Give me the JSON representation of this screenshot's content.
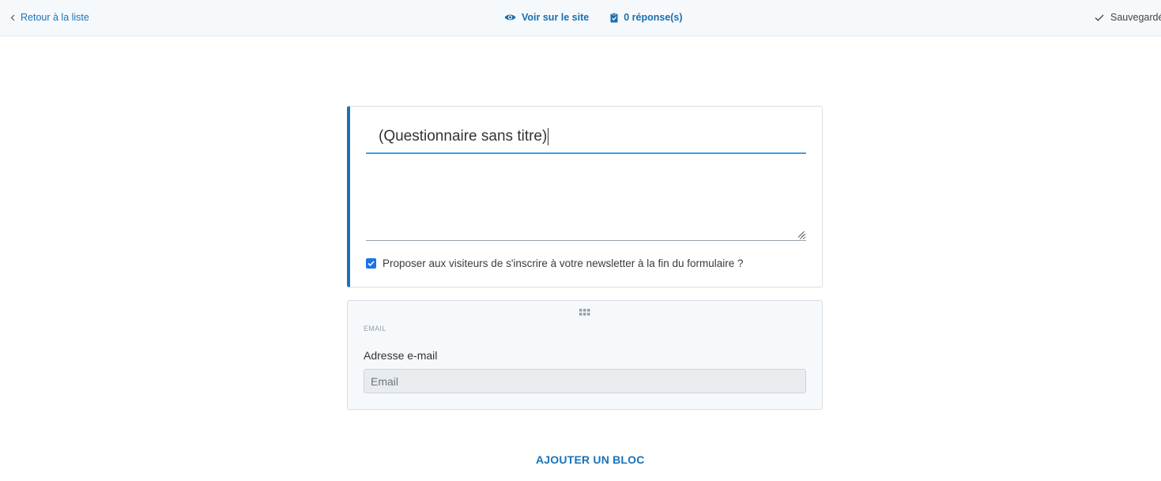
{
  "topbar": {
    "back_label": "Retour à la liste",
    "view_site_label": "Voir sur le site",
    "responses_label": "0 réponse(s)",
    "save_status": "Sauvegardé"
  },
  "form_header": {
    "title_value": "(Questionnaire sans titre)",
    "description_value": "",
    "newsletter_checked": true,
    "newsletter_label": "Proposer aux visiteurs de s'inscrire à votre newsletter à la fin du formulaire ?"
  },
  "email_block": {
    "type_label": "EMAIL",
    "field_label": "Adresse e-mail",
    "placeholder": "Email"
  },
  "add_block_label": "AJOUTER UN BLOC",
  "colors": {
    "accent": "#1a73b8",
    "checkbox": "#1a73e8",
    "input_underline": "#3d9ee8"
  }
}
